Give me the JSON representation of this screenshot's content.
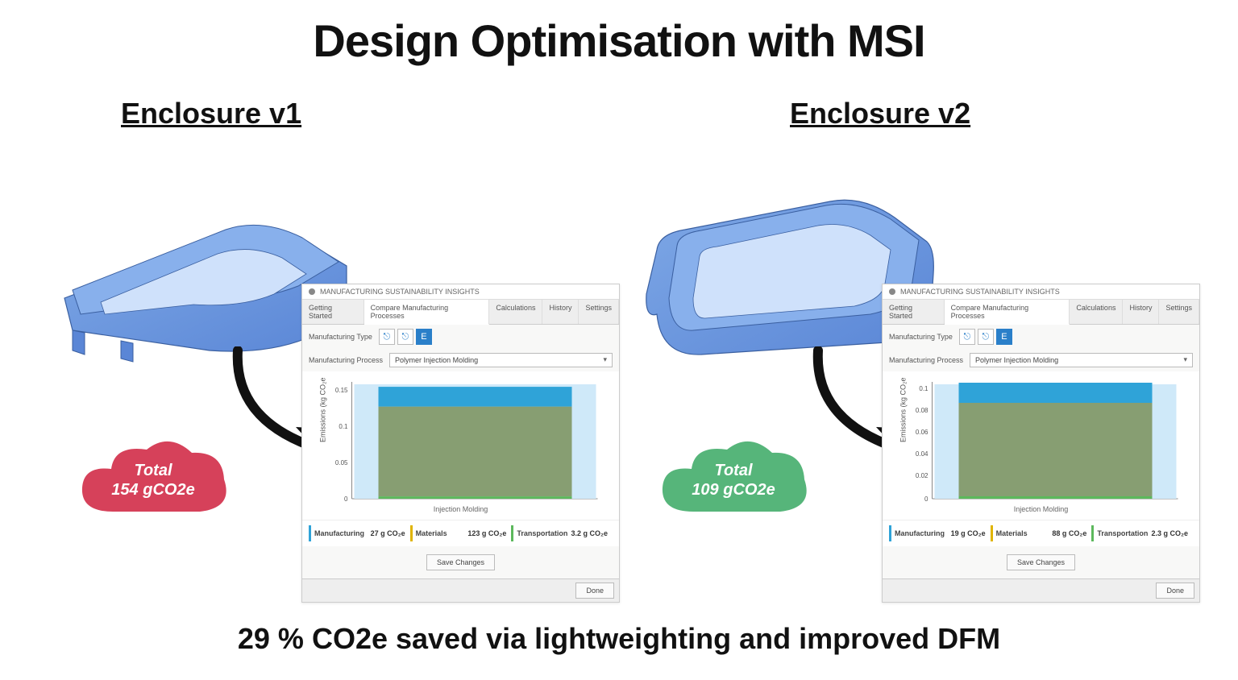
{
  "title": "Design Optimisation with MSI",
  "footer": "29 % CO2e saved via lightweighting and improved DFM",
  "panel_title": "MANUFACTURING SUSTAINABILITY INSIGHTS",
  "tabs": {
    "t0": "Getting Started",
    "t1": "Compare Manufacturing Processes",
    "t2": "Calculations",
    "t3": "History",
    "t4": "Settings"
  },
  "labels": {
    "manuf_type": "Manufacturing Type",
    "manuf_process": "Manufacturing Process",
    "ylabel": "Emissions (kg CO₂e)",
    "xlabel": "Injection Molding",
    "save": "Save Changes",
    "done": "Done"
  },
  "process_selected": "Polymer Injection Molding",
  "type_buttons": {
    "b0": "⎋",
    "b1": "⎋",
    "b2": "E"
  },
  "legend_colors": {
    "manufacturing": "#2fa3d8",
    "materials": "#e0b400",
    "transportation": "#5cb85c"
  },
  "versions": [
    {
      "heading": "Enclosure v1",
      "cloud_color": "#d6415a",
      "cloud_line1": "Total",
      "cloud_line2": "154 gCO2e",
      "legend": {
        "manufacturing": {
          "name": "Manufacturing",
          "value": "27 g CO₂e"
        },
        "materials": {
          "name": "Materials",
          "value": "123 g CO₂e"
        },
        "transportation": {
          "name": "Transportation",
          "value": "3.2 g CO₂e"
        }
      },
      "chart_data": {
        "type": "bar",
        "categories": [
          "Injection Molding"
        ],
        "series": [
          {
            "name": "Materials",
            "values": [
              0.123
            ],
            "color": "#879e72"
          },
          {
            "name": "Manufacturing",
            "values": [
              0.027
            ],
            "color": "#2fa3d8"
          },
          {
            "name": "Transportation",
            "values": [
              0.0032
            ],
            "color": "#5cb85c"
          }
        ],
        "ylabel": "Emissions (kg CO₂e)",
        "ylim": [
          0,
          0.16
        ],
        "yticks": [
          0,
          0.05,
          0.1,
          0.15
        ]
      }
    },
    {
      "heading": "Enclosure v2",
      "cloud_color": "#56b57a",
      "cloud_line1": "Total",
      "cloud_line2": "109 gCO2e",
      "legend": {
        "manufacturing": {
          "name": "Manufacturing",
          "value": "19 g CO₂e"
        },
        "materials": {
          "name": "Materials",
          "value": "88 g CO₂e"
        },
        "transportation": {
          "name": "Transportation",
          "value": "2.3 g CO₂e"
        }
      },
      "chart_data": {
        "type": "bar",
        "categories": [
          "Injection Molding"
        ],
        "series": [
          {
            "name": "Materials",
            "values": [
              0.088
            ],
            "color": "#879e72"
          },
          {
            "name": "Manufacturing",
            "values": [
              0.019
            ],
            "color": "#2fa3d8"
          },
          {
            "name": "Transportation",
            "values": [
              0.0023
            ],
            "color": "#5cb85c"
          }
        ],
        "ylabel": "Emissions (kg CO₂e)",
        "ylim": [
          0,
          0.11
        ],
        "yticks": [
          0,
          0.02,
          0.04,
          0.06,
          0.08,
          0.1
        ]
      }
    }
  ]
}
